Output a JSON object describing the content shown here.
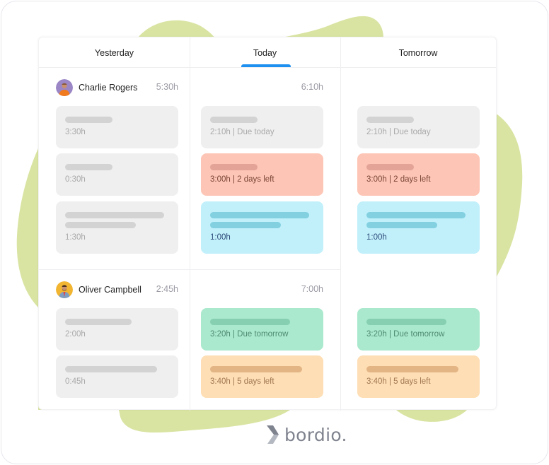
{
  "colors": {
    "accent": "#1e90ef",
    "blob": "#d9e4a2",
    "grey_card": "#efefef",
    "red_card": "#fdc5b5",
    "blue_card": "#c1f0fb",
    "green_card": "#aae9cd",
    "orange_card": "#fedeb5"
  },
  "header": {
    "days": [
      {
        "label": "Yesterday",
        "active": false
      },
      {
        "label": "Today",
        "active": true
      },
      {
        "label": "Tomorrow",
        "active": false
      }
    ]
  },
  "people": [
    {
      "name": "Charlie Rogers",
      "avatar": "avatar-charlie",
      "yesterday_hours": "5:30h",
      "today_hours": "6:10h",
      "yesterday_tasks": [
        {
          "meta": "3:30h",
          "color": "grey"
        },
        {
          "meta": "0:30h",
          "color": "grey"
        },
        {
          "meta": "1:30h",
          "color": "grey"
        }
      ],
      "today_tasks": [
        {
          "meta": "2:10h | Due today",
          "color": "grey"
        },
        {
          "meta": "3:00h | 2 days left",
          "color": "red"
        },
        {
          "meta": "1:00h",
          "color": "blue"
        }
      ],
      "tomorrow_tasks": [
        {
          "meta": "2:10h | Due today",
          "color": "grey"
        },
        {
          "meta": "3:00h | 2 days left",
          "color": "red"
        },
        {
          "meta": "1:00h",
          "color": "blue"
        }
      ]
    },
    {
      "name": "Oliver Campbell",
      "avatar": "avatar-oliver",
      "yesterday_hours": "2:45h",
      "today_hours": "7:00h",
      "yesterday_tasks": [
        {
          "meta": "2:00h",
          "color": "grey"
        },
        {
          "meta": "0:45h",
          "color": "grey"
        }
      ],
      "today_tasks": [
        {
          "meta": "3:20h | Due tomorrow",
          "color": "green"
        },
        {
          "meta": "3:40h | 5 days left",
          "color": "orange"
        }
      ],
      "tomorrow_tasks": [
        {
          "meta": "3:20h | Due tomorrow",
          "color": "green"
        },
        {
          "meta": "3:40h | 5 days left",
          "color": "orange"
        }
      ]
    }
  ],
  "brand": {
    "logo_icon": "bordio-chevron-icon",
    "name": "bordio."
  }
}
